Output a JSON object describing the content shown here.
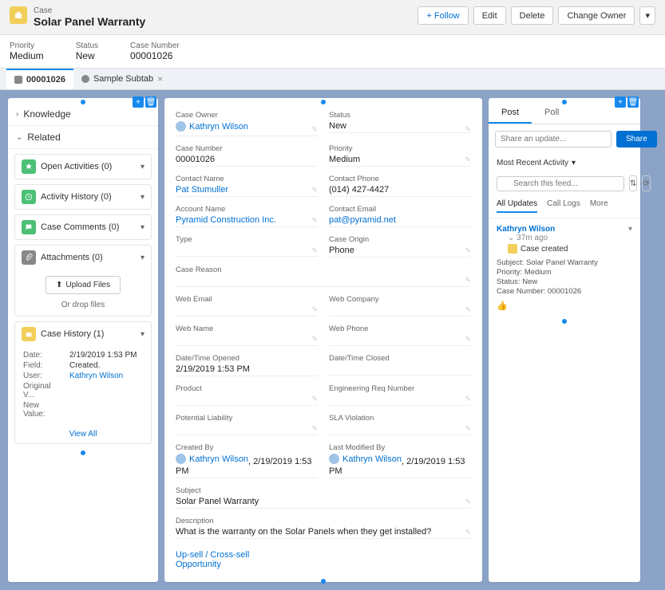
{
  "header": {
    "object_label": "Case",
    "title": "Solar Panel Warranty",
    "actions": {
      "follow": "Follow",
      "edit": "Edit",
      "delete": "Delete",
      "change_owner": "Change Owner"
    }
  },
  "highlights": {
    "priority_label": "Priority",
    "priority": "Medium",
    "status_label": "Status",
    "status": "New",
    "case_number_label": "Case Number",
    "case_number": "00001026"
  },
  "tabs": {
    "primary": "00001026",
    "subtab": "Sample Subtab"
  },
  "left": {
    "knowledge": "Knowledge",
    "related": "Related",
    "cards": {
      "open_activities": "Open Activities (0)",
      "activity_history": "Activity History (0)",
      "case_comments": "Case Comments (0)",
      "attachments": "Attachments (0)",
      "upload_files": "Upload Files",
      "drop_files": "Or drop files",
      "case_history": "Case History (1)"
    },
    "history": {
      "date_label": "Date:",
      "date": "2/19/2019 1:53 PM",
      "field_label": "Field:",
      "field": "Created.",
      "user_label": "User:",
      "user": "Kathryn Wilson",
      "original_label": "Original V...",
      "new_label": "New Value:"
    },
    "view_all": "View All"
  },
  "detail": {
    "case_owner_label": "Case Owner",
    "case_owner": "Kathryn Wilson",
    "status_label": "Status",
    "status": "New",
    "case_number_label": "Case Number",
    "case_number": "00001026",
    "priority_label": "Priority",
    "priority": "Medium",
    "contact_name_label": "Contact Name",
    "contact_name": "Pat Stumuller",
    "contact_phone_label": "Contact Phone",
    "contact_phone": "(014) 427-4427",
    "account_name_label": "Account Name",
    "account_name": "Pyramid Construction Inc.",
    "contact_email_label": "Contact Email",
    "contact_email": "pat@pyramid.net",
    "type_label": "Type",
    "case_origin_label": "Case Origin",
    "case_origin": "Phone",
    "case_reason_label": "Case Reason",
    "web_email_label": "Web Email",
    "web_company_label": "Web Company",
    "web_name_label": "Web Name",
    "web_phone_label": "Web Phone",
    "dt_opened_label": "Date/Time Opened",
    "dt_opened": "2/19/2019 1:53 PM",
    "dt_closed_label": "Date/Time Closed",
    "product_label": "Product",
    "eng_req_label": "Engineering Req Number",
    "pot_liability_label": "Potential Liability",
    "sla_label": "SLA Violation",
    "created_by_label": "Created By",
    "created_by_user": "Kathryn Wilson",
    "created_by_ts": ", 2/19/2019 1:53 PM",
    "modified_by_label": "Last Modified By",
    "modified_by_user": "Kathryn Wilson",
    "modified_by_ts": ", 2/19/2019 1:53 PM",
    "subject_label": "Subject",
    "subject": "Solar Panel Warranty",
    "description_label": "Description",
    "description": "What is the warranty on the Solar Panels when they get installed?",
    "upsell": "Up-sell / Cross-sell",
    "opportunity": "Opportunity"
  },
  "feed": {
    "post_tab": "Post",
    "poll_tab": "Poll",
    "share_placeholder": "Share an update...",
    "share_btn": "Share",
    "filter": "Most Recent Activity",
    "search_placeholder": "Search this feed...",
    "subtabs": {
      "all": "All Updates",
      "calls": "Call Logs",
      "more": "More"
    },
    "item": {
      "user": "Kathryn Wilson",
      "time": "37m ago",
      "event": "Case created",
      "subject_k": "Subject:",
      "subject_v": "Solar Panel Warranty",
      "priority_k": "Priority:",
      "priority_v": "Medium",
      "status_k": "Status:",
      "status_v": "New",
      "casenum_k": "Case Number:",
      "casenum_v": "00001026"
    }
  }
}
